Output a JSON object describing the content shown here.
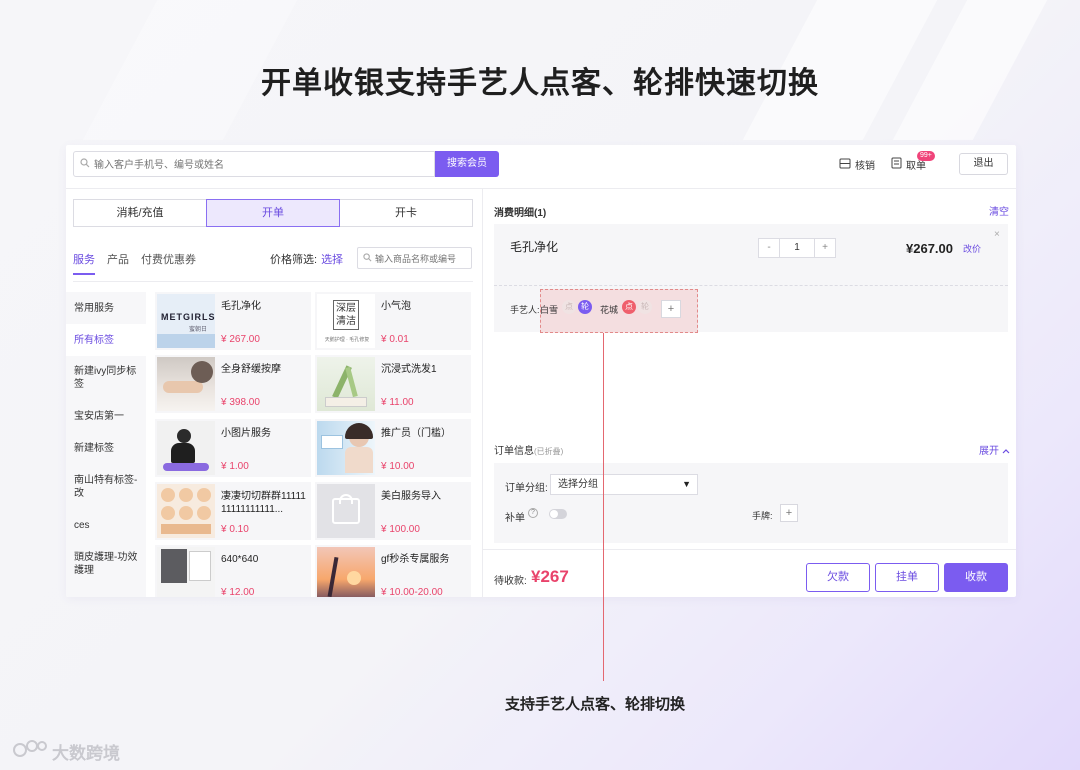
{
  "headline": "开单收银支持手艺人点客、轮排快速切换",
  "caption": "支持手艺人点客、轮排切换",
  "brand": "大数跨境",
  "accent_color": "#7b5cf0",
  "price_color": "#e9436b",
  "topbar": {
    "search_placeholder": "输入客户手机号、编号或姓名",
    "search_button": "搜索会员",
    "verify_label": "核销",
    "pickup_label": "取单",
    "pickup_badge": "99+",
    "logout_label": "退出"
  },
  "tabs": [
    "消耗/充值",
    "开单",
    "开卡"
  ],
  "categories": [
    "服务",
    "产品",
    "付费优惠券"
  ],
  "price_filter": {
    "label": "价格筛选:",
    "link": "选择"
  },
  "goods_search_placeholder": "输入商品名称或编号",
  "sidebar": [
    "常用服务",
    "所有标签",
    "新建ivy同步标签",
    "宝安店第一",
    "新建标签",
    "南山特有标签-改",
    "ces",
    "頭皮護理-功效護理"
  ],
  "products": [
    {
      "name": "毛孔净化",
      "price": "¥ 267.00",
      "thumb": "METGIRLS",
      "thumb_sub": "蜜朝日"
    },
    {
      "name": "小气泡",
      "price": "¥ 0.01",
      "thumb": "深层清洁",
      "thumb_sub": "天鹅护理 · 毛孔修复"
    },
    {
      "name": "全身舒缓按摩",
      "price": "¥ 398.00"
    },
    {
      "name": "沉浸式洗发1",
      "price": "¥ 11.00"
    },
    {
      "name": "小图片服务",
      "price": "¥ 1.00"
    },
    {
      "name": "推广员（门槛）",
      "price": "¥ 10.00"
    },
    {
      "name": "凄凄切切群群1111111111111111...",
      "price": "¥ 0.10"
    },
    {
      "name": "美白服务导入",
      "price": "¥ 100.00"
    },
    {
      "name": "640*640",
      "price": "¥ 12.00"
    },
    {
      "name": "gf秒杀专属服务",
      "price": "¥ 10.00-20.00"
    }
  ],
  "detail": {
    "title": "消费明细(1)",
    "clear": "清空",
    "item_name": "毛孔净化",
    "qty_minus": "-",
    "qty": "1",
    "qty_plus": "+",
    "item_price": "¥267.00",
    "edit_price": "改价",
    "close": "×",
    "artisan_label": "手艺人:",
    "artisans": [
      {
        "name": "白雪",
        "tag_a": "点",
        "tag_b": "轮"
      },
      {
        "name": "花城",
        "tag_a": "点",
        "tag_b": "轮"
      }
    ],
    "add": "+"
  },
  "order": {
    "title": "订单信息",
    "title_sub": "(已折叠)",
    "expand": "展开",
    "group_label": "订单分组:",
    "group_value": "选择分组",
    "supplement_label": "补单",
    "plate_label": "手牌:",
    "plate_add": "+"
  },
  "footer": {
    "due_label": "待收款:",
    "due_amount": "¥267",
    "debt": "欠款",
    "hold": "挂单",
    "checkout": "收款"
  }
}
